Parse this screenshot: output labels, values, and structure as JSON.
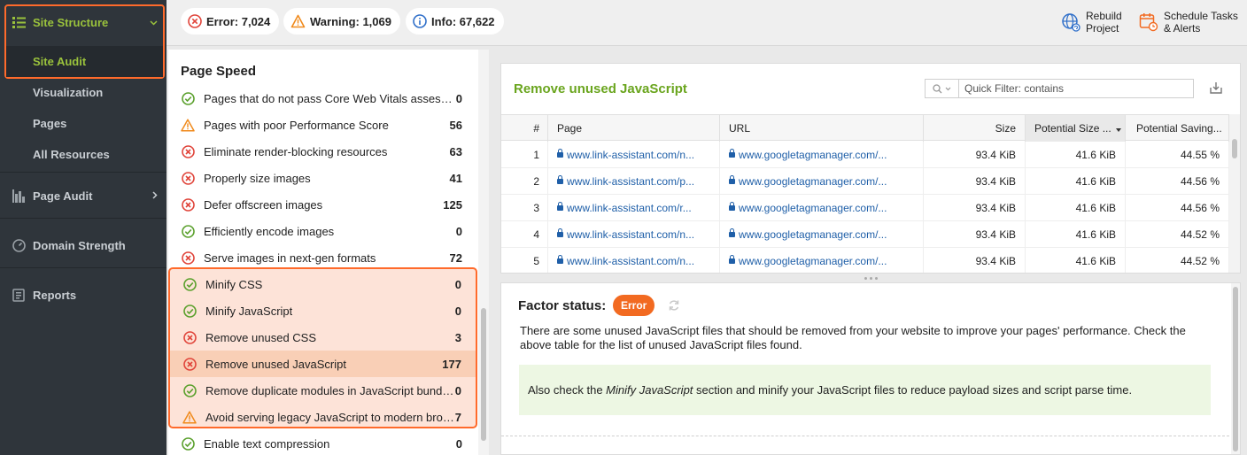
{
  "sidebar": {
    "site_structure": "Site Structure",
    "site_audit": "Site Audit",
    "visualization": "Visualization",
    "pages": "Pages",
    "all_resources": "All Resources",
    "page_audit": "Page Audit",
    "domain_strength": "Domain Strength",
    "reports": "Reports"
  },
  "topbar": {
    "error": "Error: 7,024",
    "warning": "Warning: 1,069",
    "info": "Info: 67,622",
    "rebuild_l1": "Rebuild",
    "rebuild_l2": "Project",
    "schedule_l1": "Schedule Tasks",
    "schedule_l2": "& Alerts"
  },
  "list": {
    "title": "Page Speed",
    "items": [
      {
        "label": "Pages that do not pass Core Web Vitals assessment",
        "value": "0",
        "status": "ok"
      },
      {
        "label": "Pages with poor Performance Score",
        "value": "56",
        "status": "warning"
      },
      {
        "label": "Eliminate render-blocking resources",
        "value": "63",
        "status": "error"
      },
      {
        "label": "Properly size images",
        "value": "41",
        "status": "error"
      },
      {
        "label": "Defer offscreen images",
        "value": "125",
        "status": "error"
      },
      {
        "label": "Efficiently encode images",
        "value": "0",
        "status": "ok"
      },
      {
        "label": "Serve images in next-gen formats",
        "value": "72",
        "status": "error"
      },
      {
        "label": "Minify CSS",
        "value": "0",
        "status": "ok"
      },
      {
        "label": "Minify JavaScript",
        "value": "0",
        "status": "ok"
      },
      {
        "label": "Remove unused CSS",
        "value": "3",
        "status": "error"
      },
      {
        "label": "Remove unused JavaScript",
        "value": "177",
        "status": "error"
      },
      {
        "label": "Remove duplicate modules in JavaScript bundles",
        "value": "0",
        "status": "ok"
      },
      {
        "label": "Avoid serving legacy JavaScript to modern browsers",
        "value": "7",
        "status": "warning"
      },
      {
        "label": "Enable text compression",
        "value": "0",
        "status": "ok"
      }
    ]
  },
  "table": {
    "title": "Remove unused JavaScript",
    "filter_placeholder": "Quick Filter: contains",
    "columns": [
      "#",
      "Page",
      "URL",
      "Size",
      "Potential Size ...",
      "Potential Saving..."
    ],
    "rows": [
      [
        "1",
        "www.link-assistant.com/n...",
        "www.googletagmanager.com/...",
        "93.4 KiB",
        "41.6 KiB",
        "44.55 %"
      ],
      [
        "2",
        "www.link-assistant.com/p...",
        "www.googletagmanager.com/...",
        "93.4 KiB",
        "41.6 KiB",
        "44.56 %"
      ],
      [
        "3",
        "www.link-assistant.com/r...",
        "www.googletagmanager.com/...",
        "93.4 KiB",
        "41.6 KiB",
        "44.56 %"
      ],
      [
        "4",
        "www.link-assistant.com/n...",
        "www.googletagmanager.com/...",
        "93.4 KiB",
        "41.6 KiB",
        "44.52 %"
      ],
      [
        "5",
        "www.link-assistant.com/n...",
        "www.googletagmanager.com/...",
        "93.4 KiB",
        "41.6 KiB",
        "44.52 %"
      ]
    ]
  },
  "factor": {
    "label": "Factor status:",
    "badge": "Error",
    "description": "There are some unused JavaScript files that should be removed from your website to improve your pages' performance. Check the above table for the list of unused JavaScript files found.",
    "tip_before": "Also check the ",
    "tip_em": "Minify JavaScript",
    "tip_after": " section and minify your JavaScript files to reduce payload sizes and script parse time."
  },
  "colors": {
    "accent_green": "#6aa51e",
    "highlight_orange": "#ff6a2b",
    "error_red": "#e0443a",
    "warning_orange": "#f08a1c",
    "ok_green": "#5aa02c",
    "link_blue": "#1f5fa8"
  }
}
